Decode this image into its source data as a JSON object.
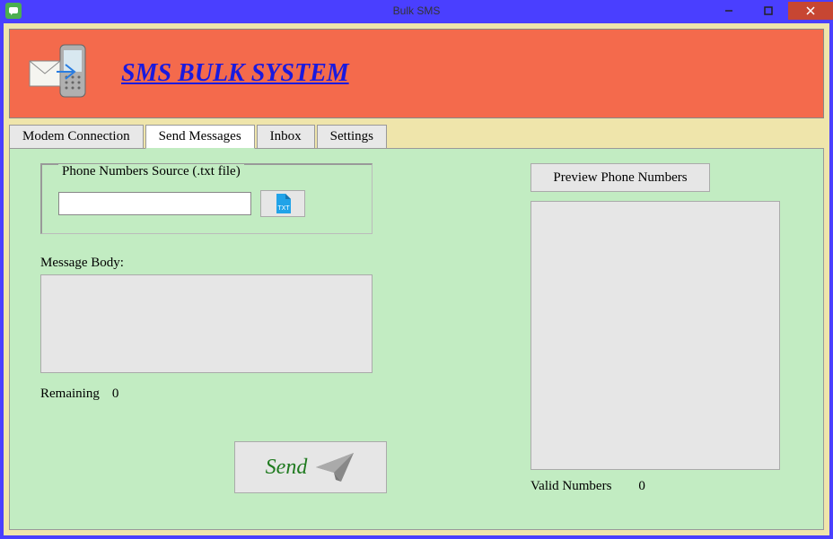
{
  "window": {
    "title": "Bulk SMS"
  },
  "banner": {
    "title": "SMS BULK SYSTEM"
  },
  "tabs": {
    "modem": "Modem Connection",
    "send": "Send Messages",
    "inbox": "Inbox",
    "settings": "Settings"
  },
  "source": {
    "legend": "Phone Numbers Source (.txt file)",
    "path": ""
  },
  "message": {
    "label": "Message Body:",
    "body": "",
    "remaining_label": "Remaining",
    "remaining_count": "0"
  },
  "send_button": "Send",
  "preview": {
    "button": "Preview Phone Numbers",
    "valid_label": "Valid Numbers",
    "valid_count": "0"
  }
}
